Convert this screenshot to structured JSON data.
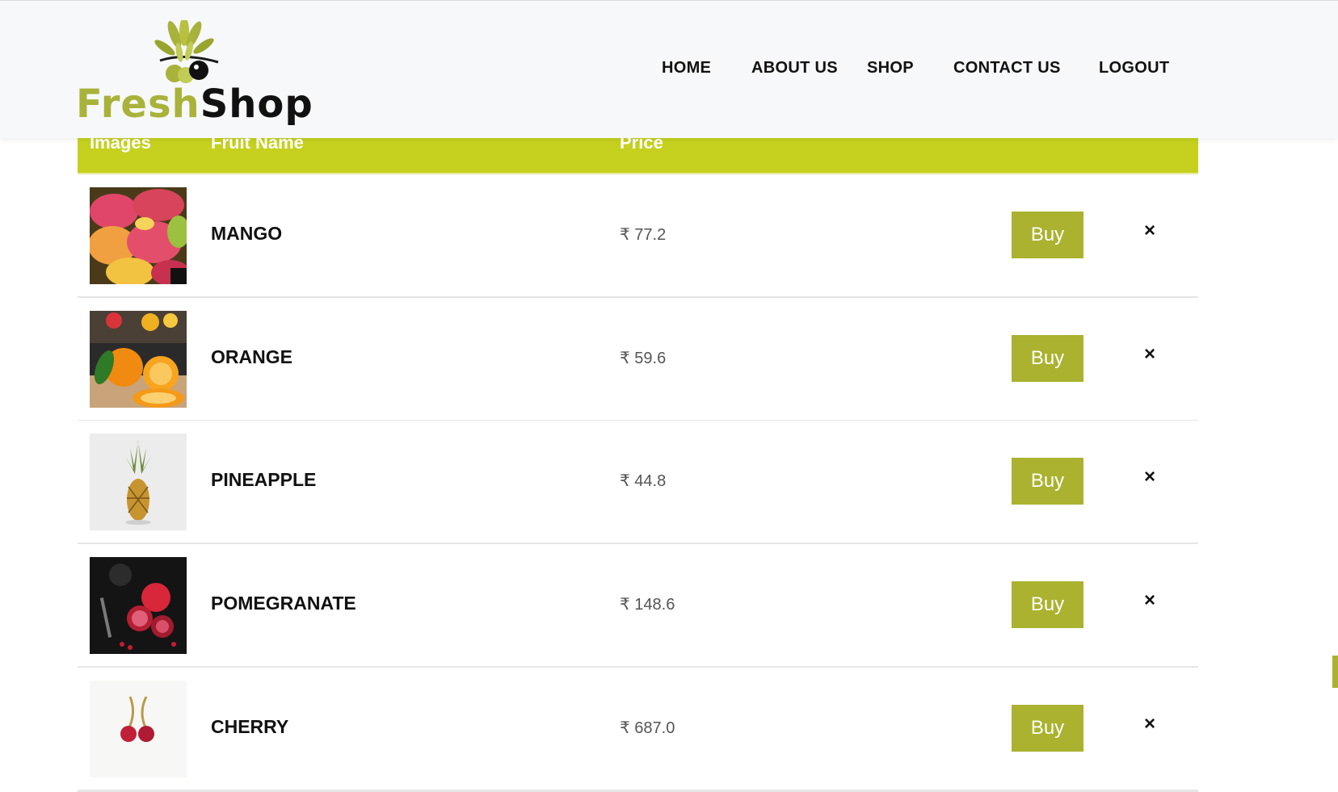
{
  "brand": {
    "part1": "Fresh",
    "part2": "Shop"
  },
  "nav": [
    "HOME",
    "ABOUT US",
    "SHOP",
    "CONTACT US",
    "LOGOUT"
  ],
  "table": {
    "headers": {
      "images": "Images",
      "name": "Fruit Name",
      "price": "Price"
    },
    "buy_label": "Buy",
    "remove_glyph": "×",
    "rows": [
      {
        "name": "MANGO",
        "price": "₹ 77.2",
        "image": "mango-photo"
      },
      {
        "name": "ORANGE",
        "price": "₹ 59.6",
        "image": "orange-photo"
      },
      {
        "name": "PINEAPPLE",
        "price": "₹ 44.8",
        "image": "pineapple-photo"
      },
      {
        "name": "POMEGRANATE",
        "price": "₹ 148.6",
        "image": "pomegranate-photo"
      },
      {
        "name": "CHERRY",
        "price": "₹ 687.0",
        "image": "cherry-photo"
      }
    ]
  },
  "colors": {
    "accent": "#aab22f",
    "table_header": "#c5d11e",
    "logo_green": "#a9b23a"
  }
}
